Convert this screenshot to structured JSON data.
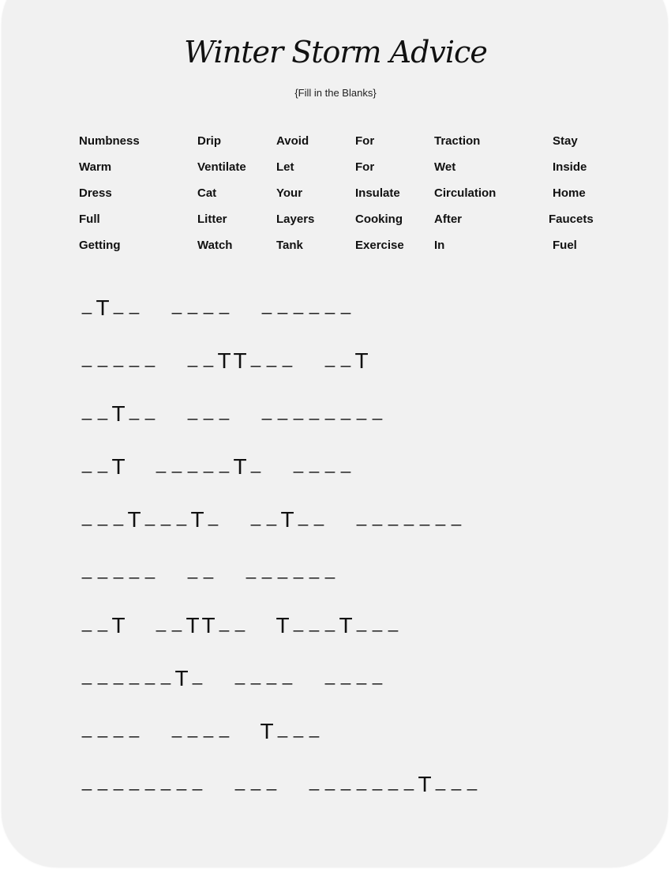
{
  "title": "Winter Storm Advice",
  "subtitle": "{Fill in the Blanks}",
  "word_bank": {
    "columns": [
      [
        "Numbness",
        "Warm",
        "Dress",
        "Full",
        "Getting"
      ],
      [
        "Drip",
        "Ventilate",
        "Cat",
        "Litter",
        "Watch"
      ],
      [
        "Avoid",
        "Let",
        "Your",
        "Layers",
        "Tank"
      ],
      [
        "For",
        "For",
        "Insulate",
        "Cooking",
        "Exercise"
      ],
      [
        "Traction",
        "Wet",
        "Circulation",
        "After",
        "In"
      ],
      [
        "Stay",
        "Inside",
        "Home",
        "Faucets",
        "Fuel"
      ]
    ]
  },
  "puzzle": {
    "rows": [
      [
        "_T__",
        "____",
        "______"
      ],
      [
        "_____",
        "__TT___",
        "__T"
      ],
      [
        "__T__",
        "___",
        "________"
      ],
      [
        "__T",
        "_____T_",
        "____"
      ],
      [
        "___T___T_",
        "__T__",
        "_______"
      ],
      [
        "_____",
        "__",
        "______"
      ],
      [
        "__T",
        "__TT__",
        "T___T___"
      ],
      [
        "______T_",
        "____",
        "____"
      ],
      [
        "____",
        "____",
        "T___"
      ],
      [
        "________",
        "___",
        "_______T___"
      ]
    ]
  }
}
